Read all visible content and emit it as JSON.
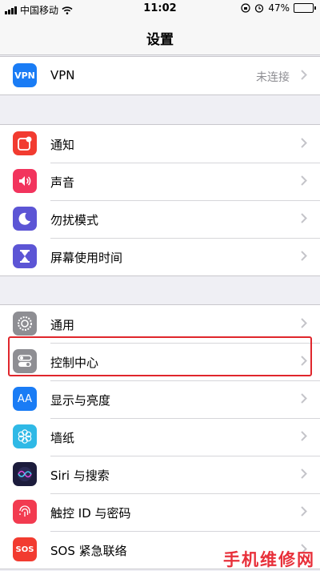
{
  "status_bar": {
    "carrier": "中国移动",
    "time": "11:02",
    "battery": "47%",
    "battery_level": 0.47
  },
  "nav": {
    "title": "设置"
  },
  "vpn": {
    "icon_text": "VPN",
    "label": "VPN",
    "value": "未连接"
  },
  "group1": [
    {
      "label": "通知",
      "icon": "notification-icon",
      "color": "#f23b30"
    },
    {
      "label": "声音",
      "icon": "speaker-icon",
      "color": "#f2345d"
    },
    {
      "label": "勿扰模式",
      "icon": "moon-icon",
      "color": "#5c55d5"
    },
    {
      "label": "屏幕使用时间",
      "icon": "hourglass-icon",
      "color": "#5c55d5"
    }
  ],
  "group2": [
    {
      "label": "通用",
      "icon": "gear-icon",
      "color": "#8e8e93"
    },
    {
      "label": "控制中心",
      "icon": "toggle-icon",
      "color": "#8e8e93"
    },
    {
      "label": "显示与亮度",
      "icon": "aa-icon",
      "color": "#1a7cf5",
      "icon_text": "AA"
    },
    {
      "label": "墙纸",
      "icon": "flower-icon",
      "color": "#2fb9e6"
    },
    {
      "label": "Siri 与搜索",
      "icon": "siri-icon",
      "color": "#1c1c3c"
    },
    {
      "label": "触控 ID 与密码",
      "icon": "fingerprint-icon",
      "color": "#f23b50"
    },
    {
      "label": "SOS 紧急联络",
      "icon": "sos-icon",
      "color": "#f23b30",
      "icon_text": "SOS"
    }
  ],
  "watermark": "手机维修网"
}
